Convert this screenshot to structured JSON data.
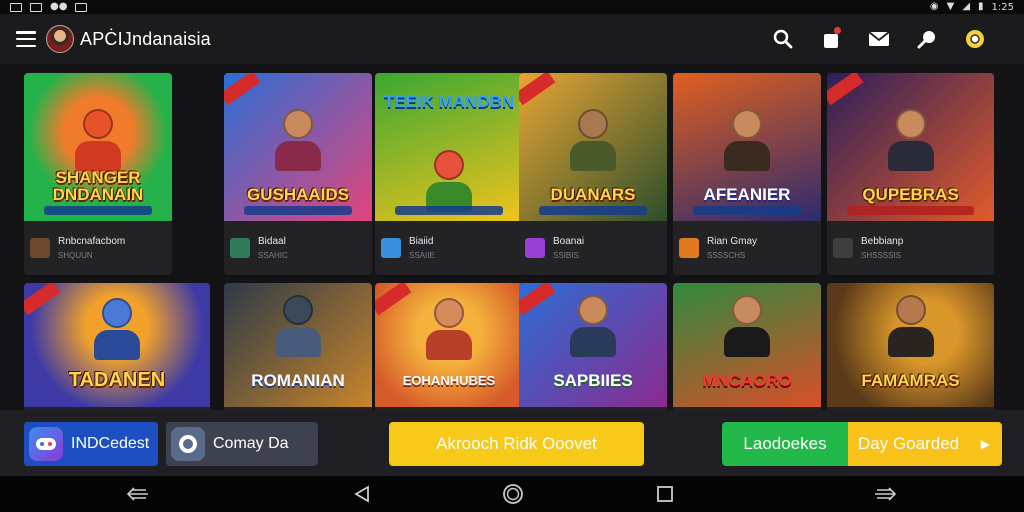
{
  "status_bar": {
    "time": "1:25"
  },
  "app_bar": {
    "title": "APĊIJndanaisia",
    "actions": [
      "search-icon",
      "notification-icon",
      "mail-icon",
      "pin-icon",
      "badge-icon"
    ]
  },
  "games": [
    {
      "title": "SHANGER DNDANAIN",
      "name": "Rnbcnafacbom",
      "sub": "SHQUUN",
      "bg1": "#26b24a",
      "bg2": "#f07b2a",
      "icon": "#6b4a2e"
    },
    {
      "title": "GUSHAAIDS",
      "name": "Bidaal",
      "sub": "SSAHIC",
      "bg1": "#2a6fd6",
      "bg2": "#e3447a",
      "icon": "#2f7d58"
    },
    {
      "title": "TEEIK MANDBN",
      "name": "Biaiid",
      "sub": "SSAIIE",
      "bg1": "#39a832",
      "bg2": "#f2c31c",
      "icon": "#3a8fe0"
    },
    {
      "title": "DUANARS",
      "name": "Boanai",
      "sub": "SSIBIS",
      "bg1": "#2d4f2b",
      "bg2": "#e8a534",
      "icon": "#9c3fd6"
    },
    {
      "title": "AFEANIER",
      "name": "Rian Gmay",
      "sub": "SSSSCHS",
      "bg1": "#e0601f",
      "bg2": "#2d2a6e",
      "icon": "#e07a1f"
    },
    {
      "title": "QUPEBRAS",
      "name": "Bebbianp",
      "sub": "SHSSSSIS",
      "bg1": "#2b1f5a",
      "bg2": "#e25b2a",
      "icon": "#3e3e3e"
    },
    {
      "title": "TADANEN",
      "name": "",
      "sub": "",
      "bg1": "#f2a22a",
      "bg2": "#3d3aa6",
      "icon": ""
    },
    {
      "title": "ROMANIAN",
      "name": "",
      "sub": "",
      "bg1": "#2d3a48",
      "bg2": "#c9852a",
      "icon": ""
    },
    {
      "title": "EOHANHUBES",
      "name": "",
      "sub": "",
      "bg1": "#f4b23c",
      "bg2": "#d65a2a",
      "icon": ""
    },
    {
      "title": "SAPBIIES",
      "name": "",
      "sub": "",
      "bg1": "#2c6ed6",
      "bg2": "#8a2a8e",
      "icon": ""
    },
    {
      "title": "MNCAORO",
      "name": "",
      "sub": "",
      "bg1": "#2f8a3e",
      "bg2": "#d94e2a",
      "icon": ""
    },
    {
      "title": "FAMAMRAS",
      "name": "",
      "sub": "",
      "bg1": "#5a3a1a",
      "bg2": "#d9962a",
      "icon": ""
    }
  ],
  "action_bar": {
    "app1_label": "INDCedest",
    "app2_label": "Comay Da",
    "center_label": "Akrooch Ridk Ooovet",
    "split_left_label": "Laodoekes",
    "split_right_label": "Day Goarded"
  },
  "nav_bar": [
    "back-icon",
    "home-icon",
    "recents-icon",
    "keyboard-icon"
  ]
}
